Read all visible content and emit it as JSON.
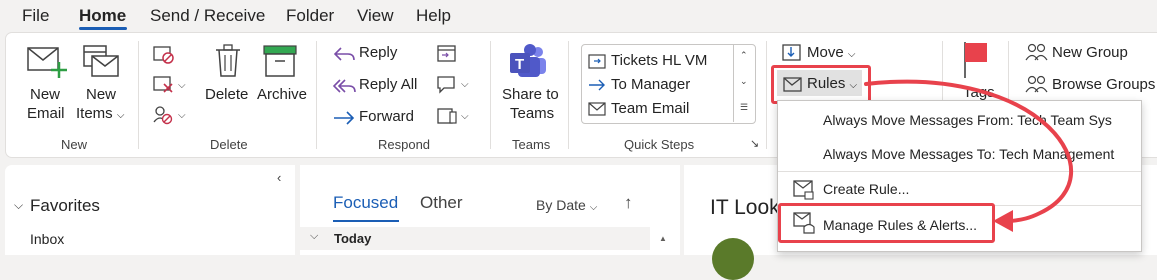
{
  "menu": {
    "tabs": [
      "File",
      "Home",
      "Send / Receive",
      "Folder",
      "View",
      "Help"
    ]
  },
  "ribbon": {
    "new_group": {
      "new_email": [
        "New",
        "Email"
      ],
      "new_items": [
        "New",
        "Items"
      ],
      "label": "New"
    },
    "delete_group": {
      "delete": "Delete",
      "archive": "Archive",
      "label": "Delete"
    },
    "respond_group": {
      "reply": "Reply",
      "reply_all": "Reply All",
      "forward": "Forward",
      "label": "Respond"
    },
    "teams_group": {
      "share": [
        "Share to",
        "Teams"
      ],
      "label": "Teams"
    },
    "quick_steps": {
      "items": [
        "Tickets HL VM",
        "To Manager",
        "Team Email"
      ],
      "label": "Quick Steps"
    },
    "move_group": {
      "move": "Move",
      "rules": "Rules"
    },
    "tags_group": {
      "tags": "Tags"
    },
    "groups_group": {
      "new_group": "New Group",
      "browse_groups": "Browse Groups"
    }
  },
  "rules_menu": {
    "items": [
      "Always Move Messages From: Tech Team Sys",
      "Always Move Messages To: Tech Management",
      "Create Rule...",
      "Manage Rules & Alerts..."
    ]
  },
  "nav": {
    "favorites": "Favorites",
    "inbox": "Inbox"
  },
  "list": {
    "focused": "Focused",
    "other": "Other",
    "sort": "By Date",
    "section": "Today"
  },
  "reading": {
    "title": "IT Look"
  },
  "colors": {
    "accent": "#1b5eb5",
    "highlight": "#e8424c",
    "teams": "#4b53bc"
  }
}
